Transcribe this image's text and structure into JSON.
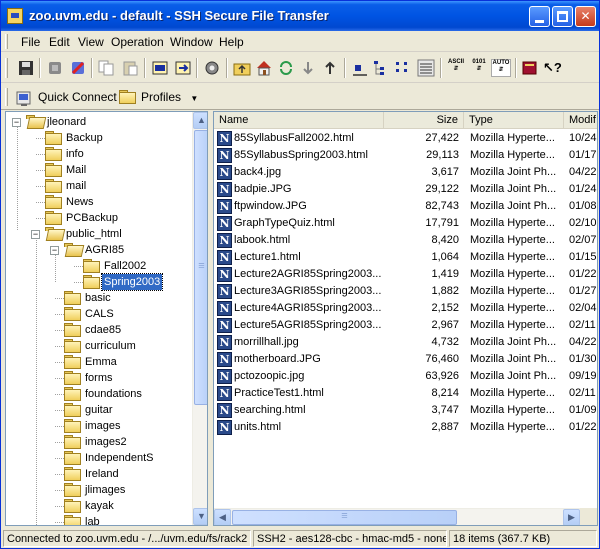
{
  "window": {
    "title": "zoo.uvm.edu - default - SSH Secure File Transfer"
  },
  "menu": [
    "File",
    "Edit",
    "View",
    "Operation",
    "Window",
    "Help"
  ],
  "toolbar": {
    "icons": [
      "save-icon",
      "disconnect-icon",
      "connect-icon",
      "copy-icon",
      "paste-icon",
      "new-terminal-icon",
      "new-transfer-icon",
      "settings-icon",
      "parent-folder-icon",
      "home-icon",
      "refresh-icon",
      "download-icon",
      "upload-icon",
      "rename-icon",
      "tree-view-icon",
      "list-view-icon",
      "details-view-icon",
      "ascii-mode-icon",
      "binary-mode-icon",
      "auto-mode-icon",
      "help-book-icon",
      "whats-this-icon"
    ],
    "mode_labels": {
      "ascii": "ASCII",
      "binary": "0101",
      "auto": "AUTO"
    }
  },
  "quickbar": {
    "quick_connect": "Quick Connect",
    "profiles": "Profiles"
  },
  "tree": {
    "root": "jleonard",
    "items": [
      {
        "label": "jleonard",
        "level": 0,
        "expanded": true
      },
      {
        "label": "Backup",
        "level": 1
      },
      {
        "label": "info",
        "level": 1
      },
      {
        "label": "Mail",
        "level": 1
      },
      {
        "label": "mail",
        "level": 1,
        "special": true
      },
      {
        "label": "News",
        "level": 1
      },
      {
        "label": "PCBackup",
        "level": 1
      },
      {
        "label": "public_html",
        "level": 1,
        "expanded": true
      },
      {
        "label": "AGRI85",
        "level": 2,
        "expanded": true
      },
      {
        "label": "Fall2002",
        "level": 3
      },
      {
        "label": "Spring2003",
        "level": 3,
        "selected": true
      },
      {
        "label": "basic",
        "level": 2
      },
      {
        "label": "CALS",
        "level": 2
      },
      {
        "label": "cdae85",
        "level": 2
      },
      {
        "label": "curriculum",
        "level": 2
      },
      {
        "label": "Emma",
        "level": 2
      },
      {
        "label": "forms",
        "level": 2
      },
      {
        "label": "foundations",
        "level": 2
      },
      {
        "label": "guitar",
        "level": 2
      },
      {
        "label": "images",
        "level": 2
      },
      {
        "label": "images2",
        "level": 2
      },
      {
        "label": "IndependentS",
        "level": 2
      },
      {
        "label": "Ireland",
        "level": 2
      },
      {
        "label": "jlimages",
        "level": 2
      },
      {
        "label": "kayak",
        "level": 2
      },
      {
        "label": "lab",
        "level": 2
      }
    ]
  },
  "list": {
    "columns": {
      "name": "Name",
      "size": "Size",
      "type": "Type",
      "modified": "Modif"
    },
    "files": [
      {
        "name": "85SyllabusFall2002.html",
        "size": "27,422",
        "type": "Mozilla Hyperte...",
        "modified": "10/24"
      },
      {
        "name": "85SyllabusSpring2003.html",
        "size": "29,113",
        "type": "Mozilla Hyperte...",
        "modified": "01/17"
      },
      {
        "name": "back4.jpg",
        "size": "3,617",
        "type": "Mozilla Joint Ph...",
        "modified": "04/22"
      },
      {
        "name": "badpie.JPG",
        "size": "29,122",
        "type": "Mozilla Joint Ph...",
        "modified": "01/24"
      },
      {
        "name": "ftpwindow.JPG",
        "size": "82,743",
        "type": "Mozilla Joint Ph...",
        "modified": "01/08"
      },
      {
        "name": "GraphTypeQuiz.html",
        "size": "17,791",
        "type": "Mozilla Hyperte...",
        "modified": "02/10"
      },
      {
        "name": "labook.html",
        "size": "8,420",
        "type": "Mozilla Hyperte...",
        "modified": "02/07"
      },
      {
        "name": "Lecture1.html",
        "size": "1,064",
        "type": "Mozilla Hyperte...",
        "modified": "01/15"
      },
      {
        "name": "Lecture2AGRI85Spring2003....",
        "size": "1,419",
        "type": "Mozilla Hyperte...",
        "modified": "01/22"
      },
      {
        "name": "Lecture3AGRI85Spring2003....",
        "size": "1,882",
        "type": "Mozilla Hyperte...",
        "modified": "01/27"
      },
      {
        "name": "Lecture4AGRI85Spring2003....",
        "size": "2,152",
        "type": "Mozilla Hyperte...",
        "modified": "02/04"
      },
      {
        "name": "Lecture5AGRI85Spring2003....",
        "size": "2,967",
        "type": "Mozilla Hyperte...",
        "modified": "02/11"
      },
      {
        "name": "morrillhall.jpg",
        "size": "4,732",
        "type": "Mozilla Joint Ph...",
        "modified": "04/22"
      },
      {
        "name": "motherboard.JPG",
        "size": "76,460",
        "type": "Mozilla Joint Ph...",
        "modified": "01/30"
      },
      {
        "name": "pctozoopic.jpg",
        "size": "63,926",
        "type": "Mozilla Joint Ph...",
        "modified": "09/19"
      },
      {
        "name": "PracticeTest1.html",
        "size": "8,214",
        "type": "Mozilla Hyperte...",
        "modified": "02/11"
      },
      {
        "name": "searching.html",
        "size": "3,747",
        "type": "Mozilla Hyperte...",
        "modified": "01/09"
      },
      {
        "name": "units.html",
        "size": "2,887",
        "type": "Mozilla Hyperte...",
        "modified": "01/22"
      }
    ]
  },
  "status": {
    "connection": "Connected to zoo.uvm.edu - /.../uvm.edu/fs/rack2",
    "cipher": "SSH2 - aes128-cbc - hmac-md5 - none",
    "items": "18 items (367.7 KB)"
  },
  "colors": {
    "titlebar": "#0054e3",
    "selection": "#316ac5",
    "folder": "#f0cf5c"
  }
}
